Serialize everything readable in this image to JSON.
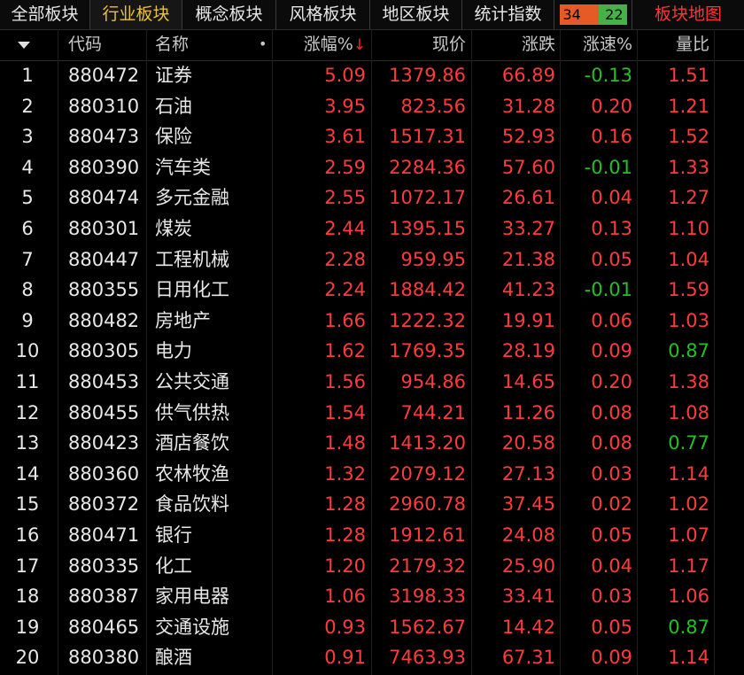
{
  "tabs": [
    {
      "label": "全部板块",
      "active": false
    },
    {
      "label": "行业板块",
      "active": true
    },
    {
      "label": "概念板块",
      "active": false
    },
    {
      "label": "风格板块",
      "active": false
    },
    {
      "label": "地区板块",
      "active": false
    },
    {
      "label": "统计指数",
      "active": false
    }
  ],
  "counter": {
    "up": "34",
    "down": "22"
  },
  "map_tab": "板块地图",
  "columns": {
    "code": "代码",
    "name": "名称",
    "name_dot": "•",
    "change_pct": "涨幅%",
    "sort_arrow": "↓",
    "price": "现价",
    "change": "涨跌",
    "speed": "涨速%",
    "volume_ratio": "量比"
  },
  "colors": {
    "up": "#ff3b3b",
    "down": "#22c122",
    "accent": "#e9c23a"
  },
  "rows": [
    {
      "idx": "1",
      "code": "880472",
      "name": "证券",
      "change_pct": "5.09",
      "price": "1379.86",
      "change": "66.89",
      "speed": "-0.13",
      "ratio": "1.51"
    },
    {
      "idx": "2",
      "code": "880310",
      "name": "石油",
      "change_pct": "3.95",
      "price": "823.56",
      "change": "31.28",
      "speed": "0.20",
      "ratio": "1.21"
    },
    {
      "idx": "3",
      "code": "880473",
      "name": "保险",
      "change_pct": "3.61",
      "price": "1517.31",
      "change": "52.93",
      "speed": "0.16",
      "ratio": "1.52"
    },
    {
      "idx": "4",
      "code": "880390",
      "name": "汽车类",
      "change_pct": "2.59",
      "price": "2284.36",
      "change": "57.60",
      "speed": "-0.01",
      "ratio": "1.33"
    },
    {
      "idx": "5",
      "code": "880474",
      "name": "多元金融",
      "change_pct": "2.55",
      "price": "1072.17",
      "change": "26.61",
      "speed": "0.04",
      "ratio": "1.27"
    },
    {
      "idx": "6",
      "code": "880301",
      "name": "煤炭",
      "change_pct": "2.44",
      "price": "1395.15",
      "change": "33.27",
      "speed": "0.13",
      "ratio": "1.10"
    },
    {
      "idx": "7",
      "code": "880447",
      "name": "工程机械",
      "change_pct": "2.28",
      "price": "959.95",
      "change": "21.38",
      "speed": "0.05",
      "ratio": "1.04"
    },
    {
      "idx": "8",
      "code": "880355",
      "name": "日用化工",
      "change_pct": "2.24",
      "price": "1884.42",
      "change": "41.23",
      "speed": "-0.01",
      "ratio": "1.59"
    },
    {
      "idx": "9",
      "code": "880482",
      "name": "房地产",
      "change_pct": "1.66",
      "price": "1222.32",
      "change": "19.91",
      "speed": "0.06",
      "ratio": "1.03"
    },
    {
      "idx": "10",
      "code": "880305",
      "name": "电力",
      "change_pct": "1.62",
      "price": "1769.35",
      "change": "28.19",
      "speed": "0.09",
      "ratio": "0.87"
    },
    {
      "idx": "11",
      "code": "880453",
      "name": "公共交通",
      "change_pct": "1.56",
      "price": "954.86",
      "change": "14.65",
      "speed": "0.20",
      "ratio": "1.38"
    },
    {
      "idx": "12",
      "code": "880455",
      "name": "供气供热",
      "change_pct": "1.54",
      "price": "744.21",
      "change": "11.26",
      "speed": "0.08",
      "ratio": "1.08"
    },
    {
      "idx": "13",
      "code": "880423",
      "name": "酒店餐饮",
      "change_pct": "1.48",
      "price": "1413.20",
      "change": "20.58",
      "speed": "0.08",
      "ratio": "0.77"
    },
    {
      "idx": "14",
      "code": "880360",
      "name": "农林牧渔",
      "change_pct": "1.32",
      "price": "2079.12",
      "change": "27.13",
      "speed": "0.03",
      "ratio": "1.14"
    },
    {
      "idx": "15",
      "code": "880372",
      "name": "食品饮料",
      "change_pct": "1.28",
      "price": "2960.78",
      "change": "37.45",
      "speed": "0.02",
      "ratio": "1.02"
    },
    {
      "idx": "16",
      "code": "880471",
      "name": "银行",
      "change_pct": "1.28",
      "price": "1912.61",
      "change": "24.08",
      "speed": "0.05",
      "ratio": "1.07"
    },
    {
      "idx": "17",
      "code": "880335",
      "name": "化工",
      "change_pct": "1.20",
      "price": "2179.32",
      "change": "25.90",
      "speed": "0.04",
      "ratio": "1.17"
    },
    {
      "idx": "18",
      "code": "880387",
      "name": "家用电器",
      "change_pct": "1.06",
      "price": "3198.33",
      "change": "33.41",
      "speed": "0.03",
      "ratio": "1.06"
    },
    {
      "idx": "19",
      "code": "880465",
      "name": "交通设施",
      "change_pct": "0.93",
      "price": "1562.67",
      "change": "14.42",
      "speed": "0.05",
      "ratio": "0.87"
    },
    {
      "idx": "20",
      "code": "880380",
      "name": "酿酒",
      "change_pct": "0.91",
      "price": "7463.93",
      "change": "67.31",
      "speed": "0.09",
      "ratio": "1.14"
    }
  ]
}
